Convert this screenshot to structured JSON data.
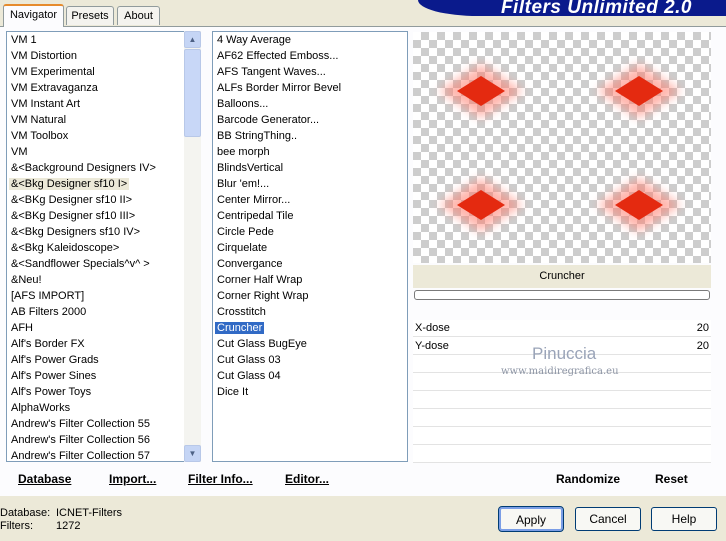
{
  "tabs": [
    {
      "label": "Navigator"
    },
    {
      "label": "Presets"
    },
    {
      "label": "About"
    }
  ],
  "app_title": "Filters Unlimited 2.0",
  "categories": [
    "VM 1",
    "VM Distortion",
    "VM Experimental",
    "VM Extravaganza",
    "VM Instant Art",
    "VM Natural",
    "VM Toolbox",
    "VM",
    "&<Background Designers IV>",
    "&<Bkg Designer sf10 I>",
    "&<BKg Designer sf10 II>",
    "&<BKg Designer sf10 III>",
    "&<Bkg Designers sf10 IV>",
    "&<Bkg Kaleidoscope>",
    "&<Sandflower Specials^v^ >",
    "&Neu!",
    "[AFS IMPORT]",
    "AB Filters 2000",
    "AFH",
    "Alf's Border FX",
    "Alf's Power Grads",
    "Alf's Power Sines",
    "Alf's Power Toys",
    "AlphaWorks",
    "Andrew's Filter Collection 55",
    "Andrew's Filter Collection 56",
    "Andrew's Filter Collection 57"
  ],
  "selected_category_index": 9,
  "filters": [
    "4 Way Average",
    "AF62 Effected Emboss...",
    "AFS Tangent Waves...",
    "ALFs Border Mirror Bevel",
    "Balloons...",
    "Barcode Generator...",
    "BB StringThing..",
    "bee morph",
    "BlindsVertical",
    "Blur 'em!...",
    "Center Mirror...",
    "Centripedal Tile",
    "Circle Pede",
    "Cirquelate",
    "Convergance",
    "Corner Half Wrap",
    "Corner Right Wrap",
    "Crosstitch",
    "Cruncher",
    "Cut Glass  BugEye",
    "Cut Glass 03",
    "Cut Glass 04",
    "Dice It"
  ],
  "selected_filter_index": 18,
  "preview": {
    "filter_name": "Cruncher",
    "accent": "#e42a10"
  },
  "params": [
    {
      "label": "X-dose",
      "value": "20"
    },
    {
      "label": "Y-dose",
      "value": "20"
    }
  ],
  "watermark": {
    "line1": "Pinuccia",
    "line2": "www.maidiregrafica.eu"
  },
  "bottom_buttons": {
    "database": "Database",
    "import": "Import...",
    "filter_info": "Filter Info...",
    "editor": "Editor...",
    "randomize": "Randomize",
    "reset": "Reset"
  },
  "status": {
    "database_label": "Database:",
    "database_value": "ICNET-Filters",
    "filters_label": "Filters:",
    "filters_value": "1272"
  },
  "dialog_buttons": {
    "apply": "Apply",
    "cancel": "Cancel",
    "help": "Help"
  }
}
